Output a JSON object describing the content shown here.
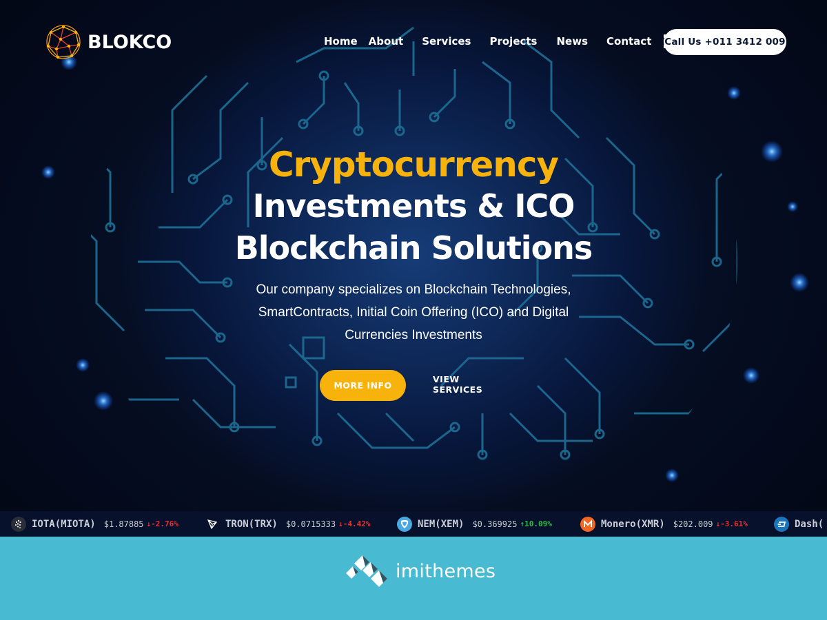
{
  "header": {
    "logo_text": "BLOKCO",
    "nav": [
      "Home",
      "About",
      "Services",
      "Projects",
      "News",
      "Contact"
    ],
    "call_button": "Call Us +011 3412 009"
  },
  "hero": {
    "headline_1": "Cryptocurrency",
    "headline_2": "Investments & ICO",
    "headline_3": "Blockchain Solutions",
    "description_1": "Our company specializes on Blockchain Technologies,",
    "description_2": "SmartContracts, Initial Coin Offering (ICO) and Digital",
    "description_3": "Currencies Investments",
    "more_info": "MORE INFO",
    "view_services": "VIEW SERVICES"
  },
  "ticker": [
    {
      "name": "IOTA(MIOTA)",
      "price": "$1.87885",
      "change": "-2.76%",
      "direction": "down",
      "icon": "iota-icon",
      "icon_color": "#2a2e38"
    },
    {
      "name": "TRON(TRX)",
      "price": "$0.0715333",
      "change": "-4.42%",
      "direction": "down",
      "icon": "tron-icon",
      "icon_color": "#07112b"
    },
    {
      "name": "NEM(XEM)",
      "price": "$0.369925",
      "change": "10.09%",
      "direction": "up",
      "icon": "nem-icon",
      "icon_color": "#4aa8e0"
    },
    {
      "name": "Monero(XMR)",
      "price": "$202.009",
      "change": "-3.61%",
      "direction": "down",
      "icon": "monero-icon",
      "icon_color": "#f26822"
    },
    {
      "name": "Dash(",
      "price": "",
      "change": "",
      "direction": "",
      "icon": "dash-icon",
      "icon_color": "#1c75bc"
    }
  ],
  "footer": {
    "brand_text": "imithemes"
  },
  "colors": {
    "accent": "#f7b20c",
    "footer_bg": "#48bbd3",
    "ticker_bg": "#07112b",
    "down": "#e8312f",
    "up": "#2dbb48"
  }
}
